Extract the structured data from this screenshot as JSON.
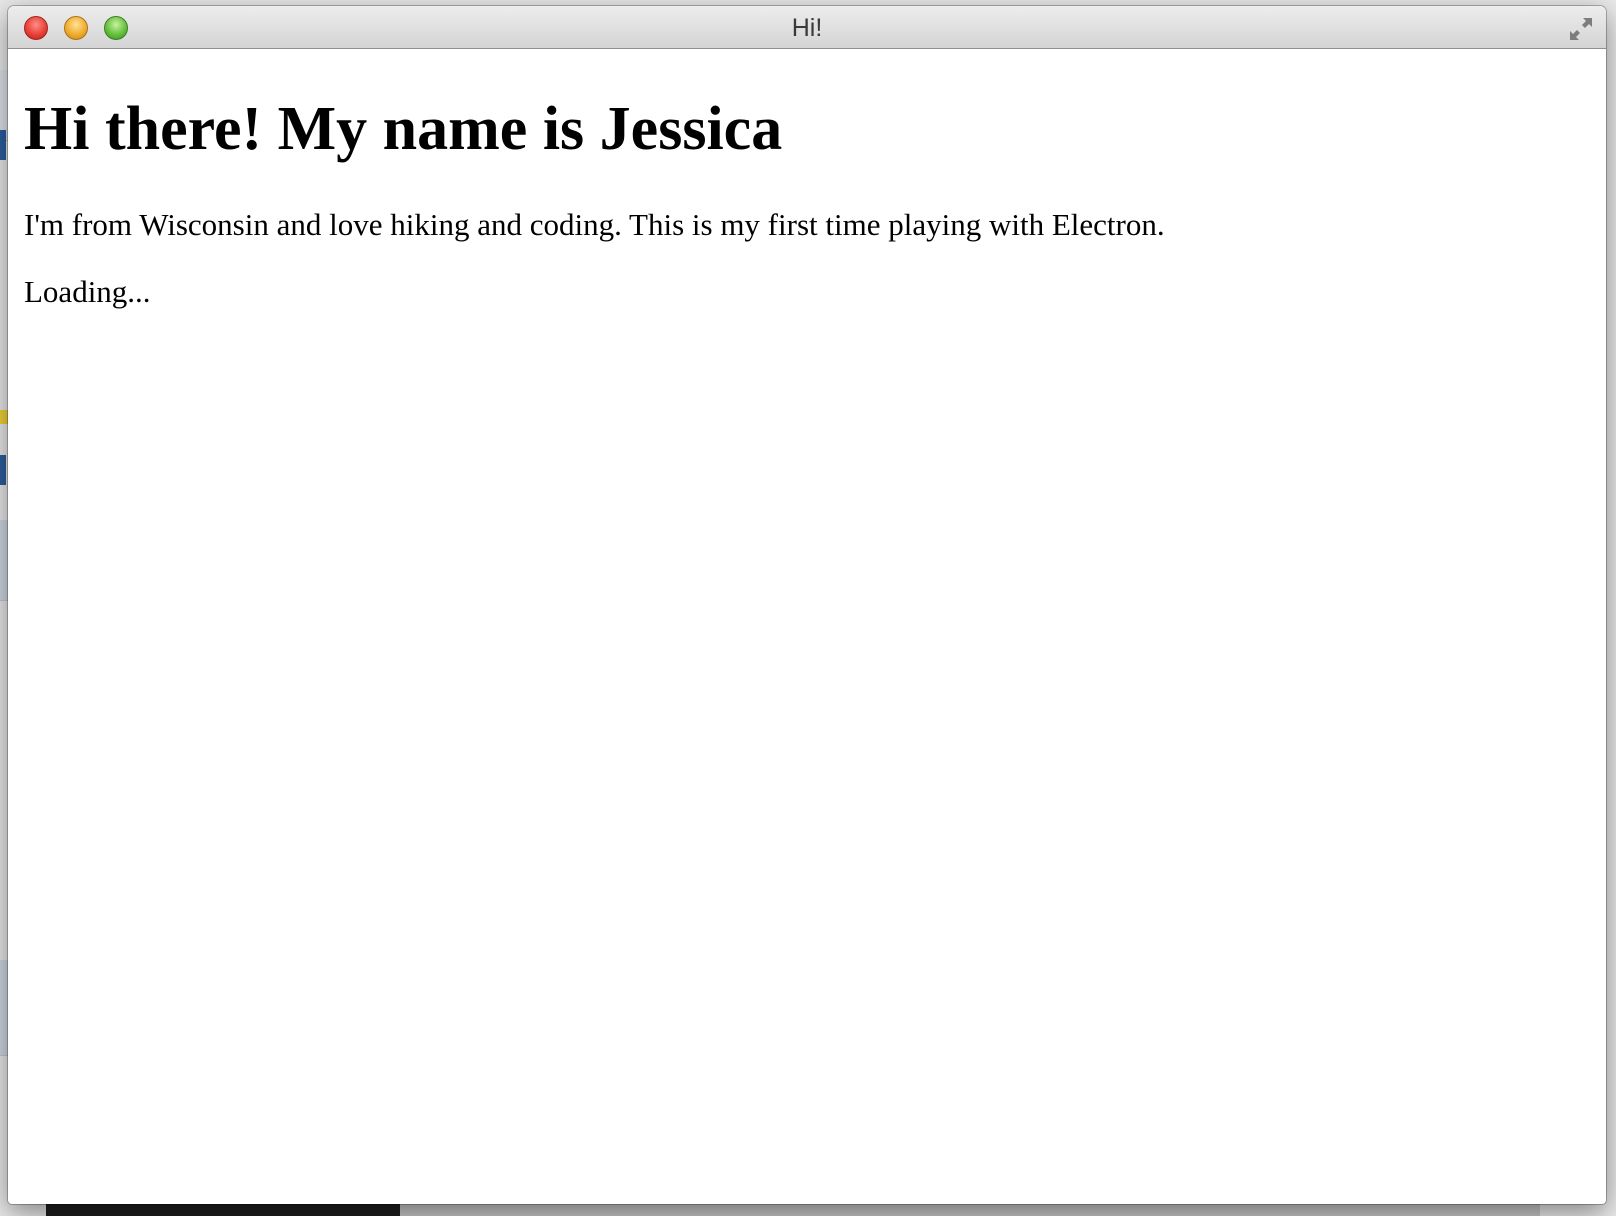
{
  "window": {
    "title": "Hi!"
  },
  "page": {
    "heading": "Hi there! My name is Jessica",
    "intro": "I'm from Wisconsin and love hiking and coding. This is my first time playing with Electron.",
    "status": "Loading..."
  },
  "icons": {
    "close": "close-icon",
    "minimize": "minimize-icon",
    "zoom": "zoom-icon",
    "fullscreen": "fullscreen-icon"
  },
  "colors": {
    "close": "#e8423a",
    "minimize": "#f2ad2c",
    "zoom": "#66c03e",
    "window_bg": "#ffffff"
  }
}
